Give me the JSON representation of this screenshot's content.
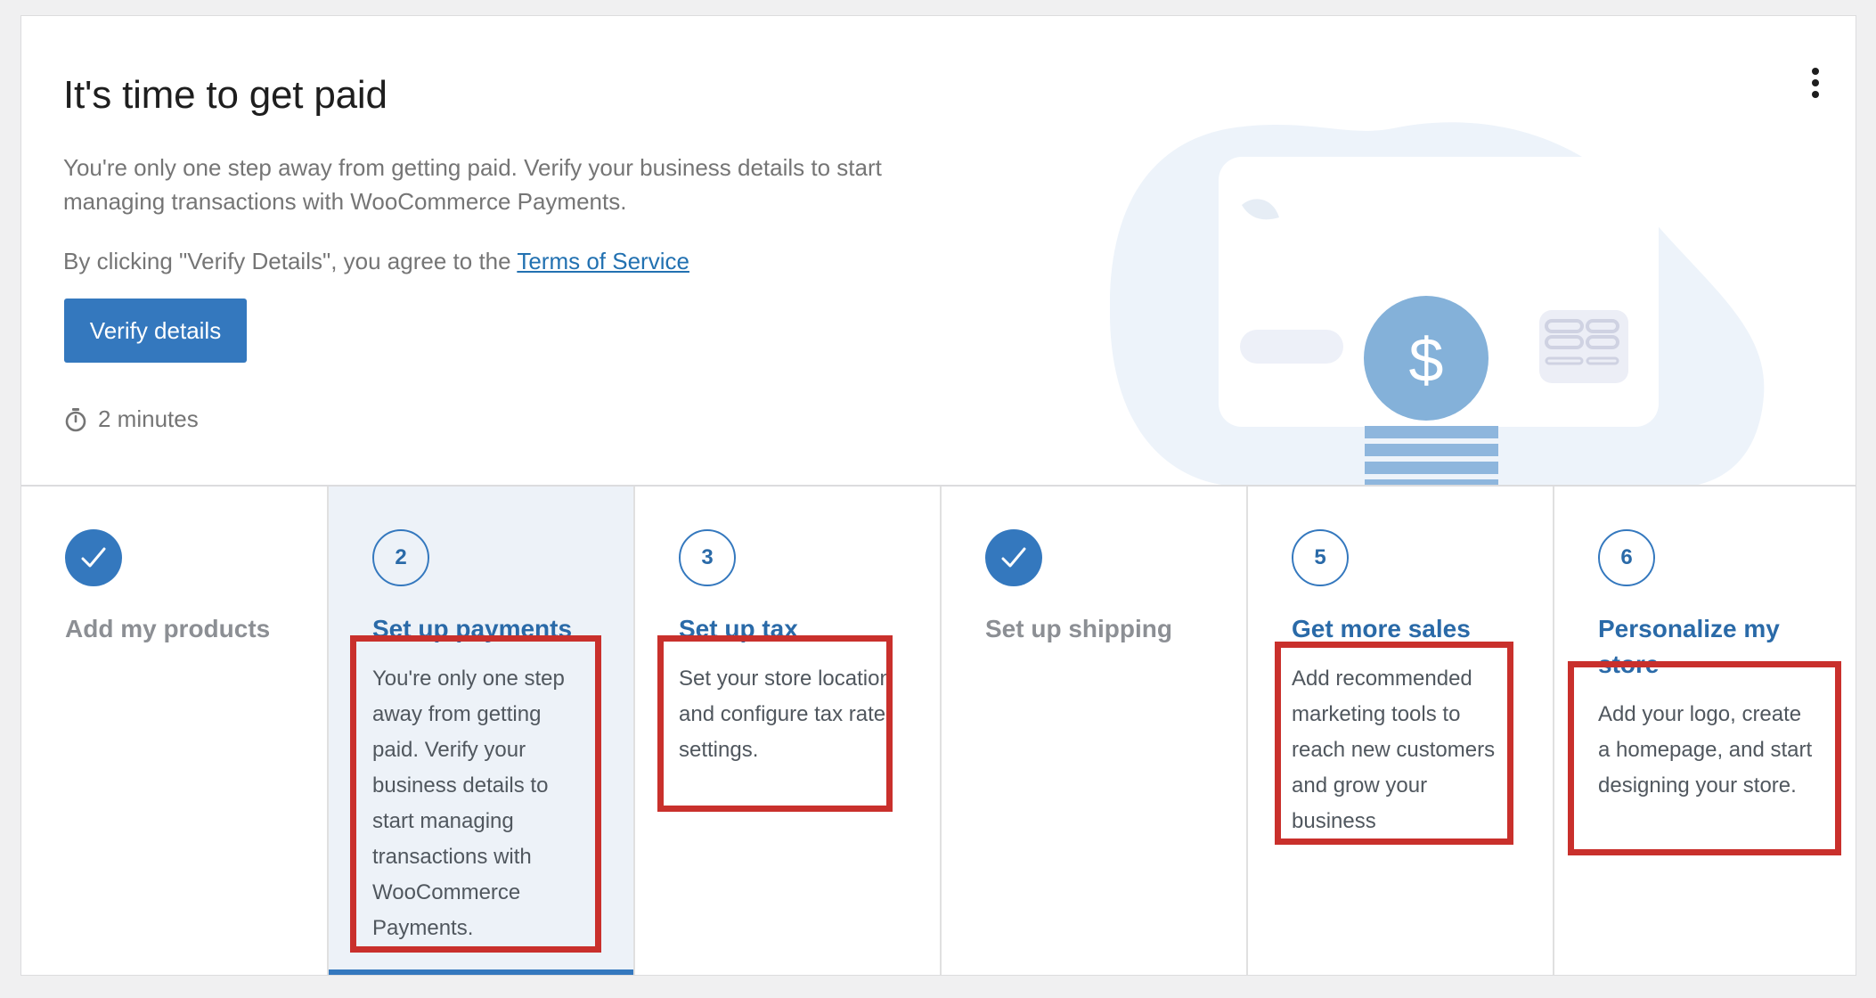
{
  "hero": {
    "title": "It's time to get paid",
    "description": "You're only one step away from getting paid. Verify your business details to start managing transactions with WooCommerce Payments.",
    "terms_prefix": "By clicking \"Verify Details\", you agree to the ",
    "terms_link": "Terms of Service",
    "button_label": "Verify details",
    "time_estimate": "2 minutes",
    "illustration_icon": "dollar-coin-card-icon"
  },
  "steps": [
    {
      "badge": "",
      "status": "complete",
      "title": "Add my products",
      "description": ""
    },
    {
      "badge": "2",
      "status": "active",
      "title": "Set up payments",
      "description": "You're only one step away from getting paid. Verify your business details to start managing transactions with WooCommerce Payments."
    },
    {
      "badge": "3",
      "status": "todo",
      "title": "Set up tax",
      "description": "Set your store location and configure tax rate settings."
    },
    {
      "badge": "",
      "status": "complete",
      "title": "Set up shipping",
      "description": ""
    },
    {
      "badge": "5",
      "status": "todo",
      "title": "Get more sales",
      "description": "Add recommended marketing tools to reach new customers and grow your business"
    },
    {
      "badge": "6",
      "status": "todo",
      "title": "Personalize my store",
      "description": "Add your logo, create a homepage, and start designing your store."
    }
  ],
  "colors": {
    "accent": "#3478be",
    "link": "#2a6aa8",
    "highlight_box": "#c9302c",
    "muted_text": "#757575"
  }
}
